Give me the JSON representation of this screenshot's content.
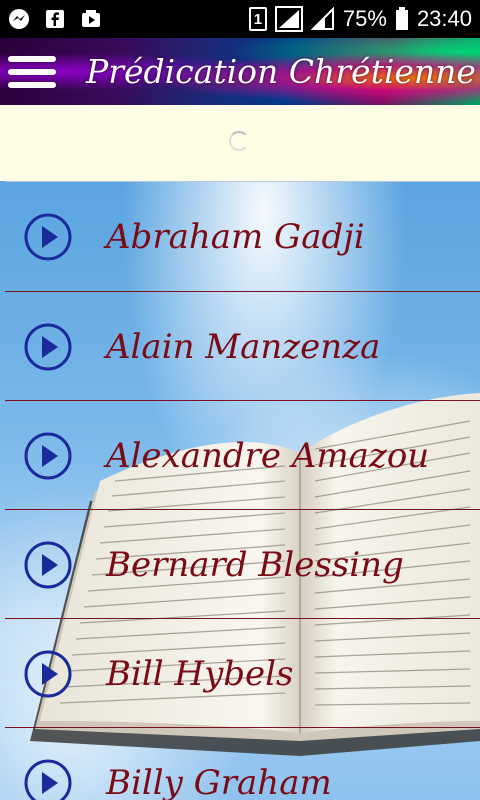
{
  "status_bar": {
    "icons": [
      "messenger-icon",
      "facebook-icon",
      "photo-video-icon"
    ],
    "sim": "1",
    "battery": "75%",
    "time": "23:40"
  },
  "app_bar": {
    "title": "Prédication Chrétienne",
    "menu_icon": "hamburger-menu-icon"
  },
  "list": {
    "items": [
      {
        "label": "Abraham Gadji"
      },
      {
        "label": "Alain Manzenza"
      },
      {
        "label": "Alexandre Amazou"
      },
      {
        "label": "Bernard Blessing"
      },
      {
        "label": "Bill Hybels"
      },
      {
        "label": "Billy Graham"
      }
    ]
  },
  "colors": {
    "item_text": "#7a0a14",
    "divider": "#7a1020",
    "play_icon": "#1a2a9a",
    "ad_background": "#fdfde6"
  }
}
